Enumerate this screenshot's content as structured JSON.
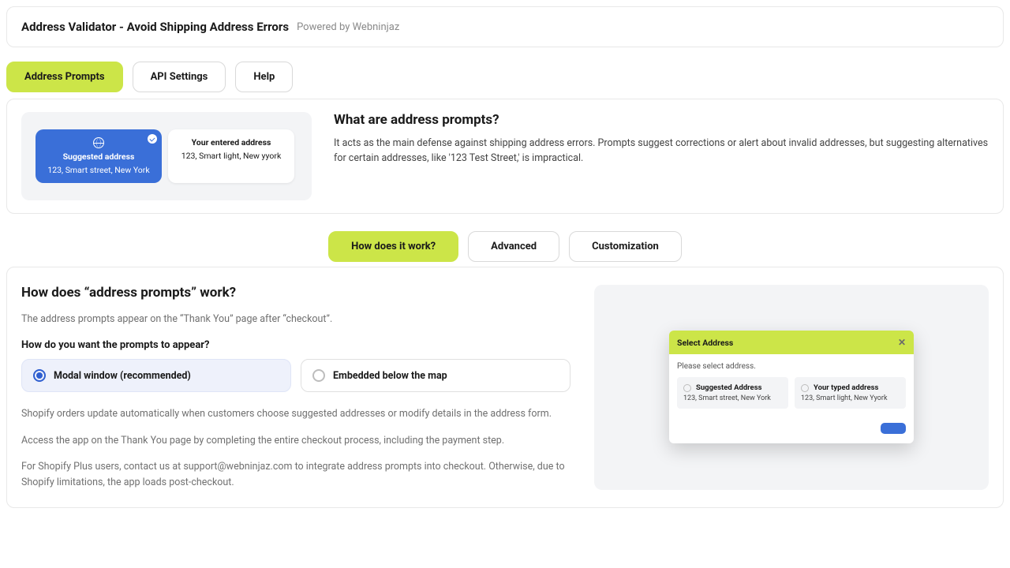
{
  "header": {
    "title": "Address Validator - Avoid Shipping Address Errors",
    "powered": "Powered by Webninjaz"
  },
  "nav": [
    "Address Prompts",
    "API Settings",
    "Help"
  ],
  "preview": {
    "suggested": {
      "title": "Suggested address",
      "addr": "123, Smart street, New York"
    },
    "entered": {
      "title": "Your entered address",
      "addr": "123, Smart light, New yyork"
    }
  },
  "what": {
    "heading": "What are address prompts?",
    "body": "It acts as the main defense against shipping address errors. Prompts suggest corrections or alert about invalid addresses, but suggesting alternatives for certain addresses, like '123 Test Street,' is impractical."
  },
  "subnav": [
    "How does it work?",
    "Advanced",
    "Customization"
  ],
  "how": {
    "heading": "How does “address prompts” work?",
    "intro": "The address prompts appear on the “Thank You” page after “checkout”.",
    "question": "How do you want the prompts to appear?",
    "options": [
      "Modal window (recommended)",
      "Embedded below the map"
    ],
    "notes": [
      "Shopify orders update automatically when customers choose suggested addresses or modify details in the address form.",
      "Access the app on the Thank You page by completing the entire checkout process, including the payment step.",
      "For Shopify Plus users, contact us at support@webninjaz.com to integrate address prompts into checkout. Otherwise, due to Shopify limitations, the app loads post-checkout."
    ]
  },
  "modal": {
    "title": "Select Address",
    "please": "Please select address.",
    "opts": [
      {
        "t": "Suggested Address",
        "s": "123, Smart street, New York"
      },
      {
        "t": "Your typed address",
        "s": "123, Smart light, New Yyork"
      }
    ]
  }
}
